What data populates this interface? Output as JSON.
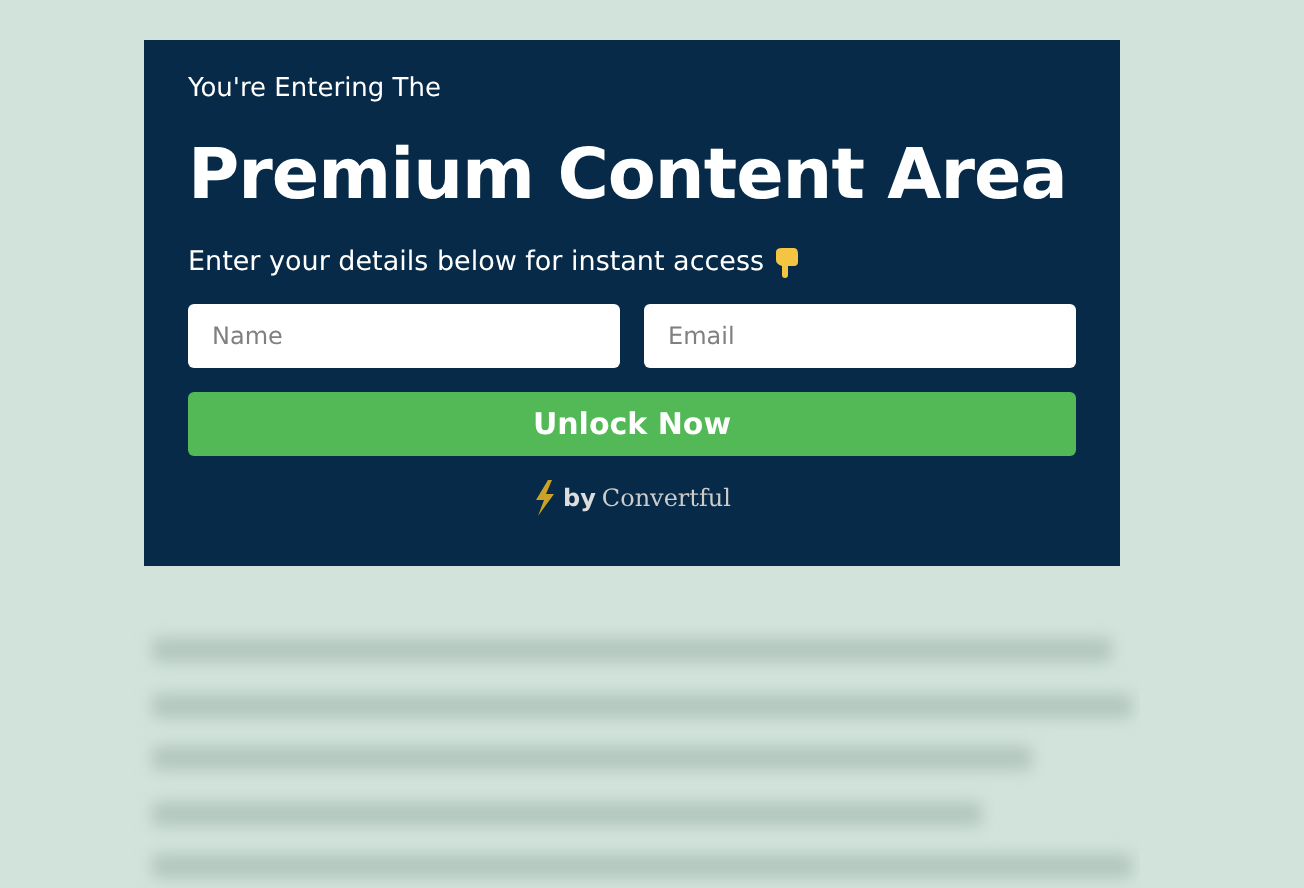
{
  "gate": {
    "kicker": "You're Entering The",
    "title": "Premium Content Area",
    "subtitle": "Enter your details below for instant access",
    "fields": [
      {
        "placeholder": "Name"
      },
      {
        "placeholder": "Email"
      }
    ],
    "button": "Unlock Now",
    "credit": {
      "by": "by",
      "brand": "Convertful"
    }
  }
}
